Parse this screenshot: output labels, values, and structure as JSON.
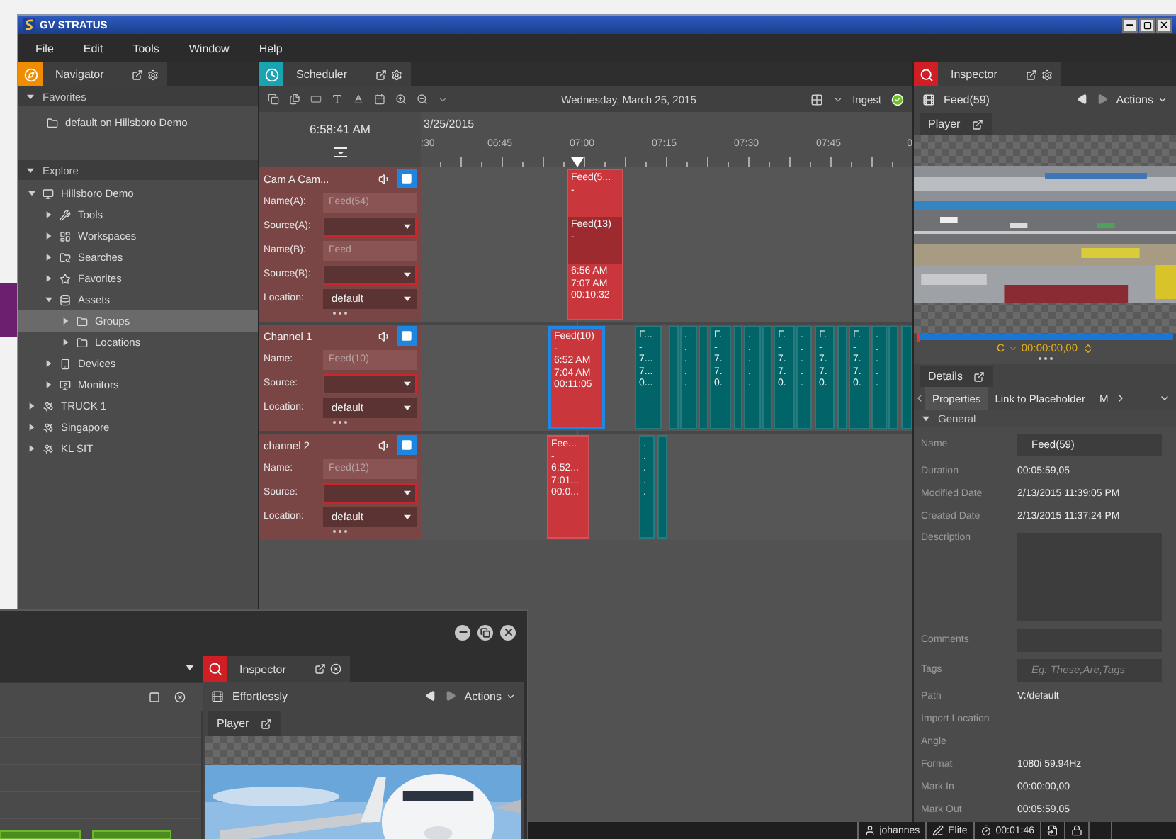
{
  "window": {
    "title": "GV STRATUS"
  },
  "menu": [
    "File",
    "Edit",
    "Tools",
    "Window",
    "Help"
  ],
  "navigator": {
    "tab": "Navigator",
    "sections": [
      {
        "title": "Favorites",
        "expanded": true,
        "items": [
          {
            "label": "default on Hillsboro Demo",
            "kind": "folder"
          }
        ]
      },
      {
        "title": "Explore",
        "expanded": true,
        "tree": [
          {
            "label": "Hillsboro Demo",
            "kind": "computer",
            "expanded": true,
            "selected": false,
            "children": [
              {
                "label": "Tools",
                "kind": "tools",
                "expanded": false,
                "selected": false
              },
              {
                "label": "Workspaces",
                "kind": "workspaces",
                "expanded": false,
                "selected": false
              },
              {
                "label": "Searches",
                "kind": "searches",
                "expanded": false,
                "selected": false
              },
              {
                "label": "Favorites",
                "kind": "favorites",
                "expanded": false,
                "selected": false
              },
              {
                "label": "Assets",
                "kind": "assets",
                "expanded": true,
                "selected": false,
                "children": [
                  {
                    "label": "Groups",
                    "kind": "folder",
                    "expanded": false,
                    "selected": true
                  },
                  {
                    "label": "Locations",
                    "kind": "folder",
                    "expanded": false,
                    "selected": false
                  }
                ]
              },
              {
                "label": "Devices",
                "kind": "devices",
                "expanded": false,
                "selected": false
              },
              {
                "label": "Monitors",
                "kind": "monitors",
                "expanded": false,
                "selected": false
              }
            ]
          },
          {
            "label": "TRUCK 1",
            "kind": "satellite",
            "expanded": false,
            "selected": false
          },
          {
            "label": "Singapore",
            "kind": "satellite",
            "expanded": false,
            "selected": false
          },
          {
            "label": "KL SIT",
            "kind": "satellite",
            "expanded": false,
            "selected": false
          }
        ]
      }
    ]
  },
  "scheduler": {
    "tab": "Scheduler",
    "date": "Wednesday, March 25, 2015",
    "ingest": {
      "label": "Ingest",
      "ok": true
    },
    "clock": "6:58:41 AM",
    "ruler": {
      "date": "3/25/2015",
      "labels": [
        ":30",
        "06:45",
        "07:00",
        "07:15",
        "07:30",
        "07:45",
        "0"
      ]
    },
    "channels": [
      {
        "name": "Cam A  Cam...",
        "fields": [
          {
            "label": "Name(A):",
            "kind": "text",
            "placeholder": "Feed(54)"
          },
          {
            "label": "Source(A):",
            "kind": "select",
            "invalid": true
          },
          {
            "label": "Name(B):",
            "kind": "text",
            "placeholder": "Feed"
          },
          {
            "label": "Source(B):",
            "kind": "select",
            "invalid": true
          },
          {
            "label": "Location:",
            "kind": "select",
            "value": "default",
            "invalid": false
          }
        ],
        "events": [
          {
            "color": "#c9363b",
            "selected": false,
            "parts": [
              {
                "kind": "normal",
                "lines": [
                  "Feed(5...",
                  "-"
                ]
              },
              {
                "kind": "dark",
                "lines": [
                  "Feed(13)",
                  "-"
                ]
              },
              {
                "kind": "normal",
                "lines": [
                  "6:56 AM",
                  "7:07 AM",
                  "00:10:32"
                ]
              }
            ]
          }
        ]
      },
      {
        "name": "Channel 1",
        "fields": [
          {
            "label": "Name:",
            "kind": "text",
            "placeholder": "Feed(10)"
          },
          {
            "label": "Source:",
            "kind": "select",
            "invalid": true
          },
          {
            "label": "Location:",
            "kind": "select",
            "value": "default",
            "invalid": false
          }
        ],
        "events": [
          {
            "color": "#c9363b",
            "selected": true,
            "parts": [
              {
                "kind": "normal",
                "lines": [
                  "Feed(10)",
                  "-",
                  "6:52 AM",
                  "7:04 AM",
                  "00:11:05"
                ]
              }
            ]
          },
          {
            "color": "#006468",
            "selected": false,
            "parts": [
              {
                "kind": "normal",
                "lines": [
                  "F...",
                  "-",
                  "7...",
                  "7...",
                  "0..."
                ]
              }
            ]
          },
          {
            "color": "#006468",
            "selected": false
          },
          {
            "color": "#006468",
            "selected": false,
            "parts": [
              {
                "kind": "normal",
                "lines": [
                  ".",
                  ".",
                  ".",
                  ".",
                  "."
                ]
              }
            ]
          },
          {
            "color": "#006468",
            "selected": false
          },
          {
            "color": "#006468",
            "selected": false,
            "parts": [
              {
                "kind": "normal",
                "lines": [
                  "F.",
                  "-",
                  "7.",
                  "7.",
                  "0."
                ]
              }
            ]
          },
          {
            "color": "#006468",
            "selected": false
          },
          {
            "color": "#006468",
            "selected": false,
            "parts": [
              {
                "kind": "normal",
                "lines": [
                  ".",
                  ".",
                  ".",
                  ".",
                  "."
                ]
              }
            ]
          },
          {
            "color": "#006468",
            "selected": false
          },
          {
            "color": "#006468",
            "selected": false,
            "parts": [
              {
                "kind": "normal",
                "lines": [
                  "F.",
                  "-",
                  "7.",
                  "7.",
                  "0."
                ]
              }
            ]
          },
          {
            "color": "#006468",
            "selected": false,
            "parts": [
              {
                "kind": "normal",
                "lines": [
                  ".",
                  ".",
                  ".",
                  ".",
                  "."
                ]
              }
            ]
          },
          {
            "color": "#006468",
            "selected": false,
            "parts": [
              {
                "kind": "normal",
                "lines": [
                  "F.",
                  "-",
                  "7.",
                  "7.",
                  "0."
                ]
              }
            ]
          },
          {
            "color": "#006468",
            "selected": false
          },
          {
            "color": "#006468",
            "selected": false,
            "parts": [
              {
                "kind": "normal",
                "lines": [
                  "F.",
                  "-",
                  "7.",
                  "7.",
                  "0."
                ]
              }
            ]
          },
          {
            "color": "#006468",
            "selected": false,
            "parts": [
              {
                "kind": "normal",
                "lines": [
                  ".",
                  ".",
                  ".",
                  ".",
                  "."
                ]
              }
            ]
          },
          {
            "color": "#006468",
            "selected": false
          },
          {
            "color": "#006468",
            "selected": false
          }
        ]
      },
      {
        "name": "channel 2",
        "fields": [
          {
            "label": "Name:",
            "kind": "text",
            "placeholder": "Feed(12)"
          },
          {
            "label": "Source:",
            "kind": "select",
            "invalid": true
          },
          {
            "label": "Location:",
            "kind": "select",
            "value": "default",
            "invalid": false
          }
        ],
        "events": [
          {
            "color": "#c9363b",
            "selected": false,
            "parts": [
              {
                "kind": "normal",
                "lines": [
                  "Fee...",
                  "-",
                  "6:52...",
                  "7:01...",
                  "00:0..."
                ]
              }
            ]
          },
          {
            "color": "#006468",
            "selected": false,
            "parts": [
              {
                "kind": "normal",
                "lines": [
                  ".",
                  ".",
                  ".",
                  ".",
                  "."
                ]
              }
            ]
          },
          {
            "color": "#006468",
            "selected": false
          }
        ]
      }
    ]
  },
  "inspector": {
    "tab": "Inspector",
    "asset": "Feed(59)",
    "actions": "Actions",
    "player_tab": "Player",
    "scrubber": {
      "level": 0
    },
    "timecode_mode": "C",
    "timecode": "00:00:00,00",
    "details_tab": "Details",
    "subtabs": [
      {
        "label": "Properties",
        "selected": true
      },
      {
        "label": "Link to Placeholder",
        "selected": false
      },
      {
        "label": "M",
        "selected": false
      }
    ],
    "section": "General",
    "properties": [
      {
        "label": "Name",
        "kind": "field",
        "value": "Feed(59)"
      },
      {
        "label": "Duration",
        "kind": "text",
        "value": "00:05:59,05"
      },
      {
        "label": "Modified Date",
        "kind": "text",
        "value": "2/13/2015 11:39:05 PM"
      },
      {
        "label": "Created Date",
        "kind": "text",
        "value": "2/13/2015 11:37:24 PM"
      },
      {
        "label": "Description",
        "kind": "area"
      },
      {
        "label": "Comments",
        "kind": "field"
      },
      {
        "label": "Tags",
        "kind": "field",
        "placeholder": "Eg: These,Are,Tags"
      },
      {
        "label": "Path",
        "kind": "text",
        "value": "V:/default"
      },
      {
        "label": "Import Location",
        "kind": "text"
      },
      {
        "label": "Angle",
        "kind": "text"
      },
      {
        "label": "Format",
        "kind": "text",
        "value": "1080i 59.94Hz"
      },
      {
        "label": "Mark In",
        "kind": "text",
        "value": "00:00:00,00"
      },
      {
        "label": "Mark Out",
        "kind": "text",
        "value": "00:05:59,05"
      }
    ]
  },
  "status_bar": {
    "user": "johannes",
    "role": "Elite",
    "timer": "00:01:46"
  },
  "second_window": {
    "inspector_tab": "Inspector",
    "asset": "Effortlessly",
    "actions": "Actions",
    "player_tab": "Player"
  }
}
